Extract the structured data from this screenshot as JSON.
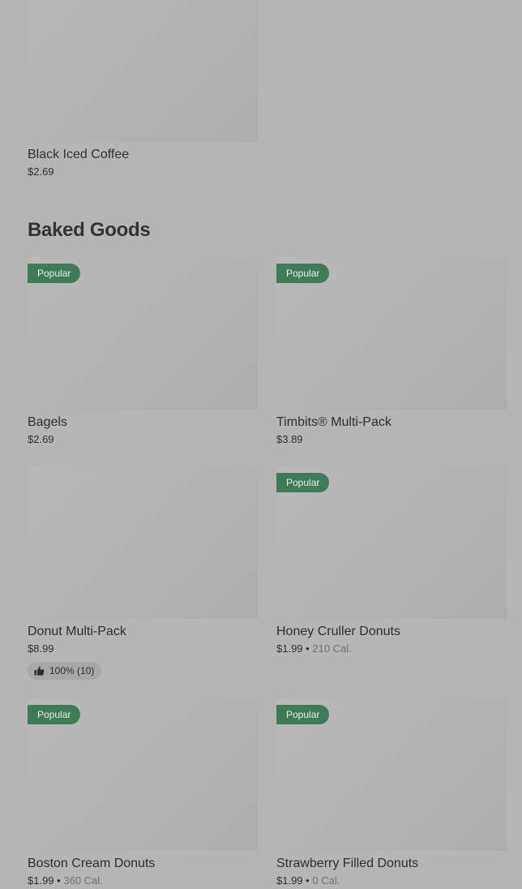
{
  "top_item": {
    "name": "Black Iced Coffee",
    "price": "$2.69"
  },
  "section": {
    "title": "Baked Goods"
  },
  "badge_label": "Popular",
  "items": [
    {
      "name": "Bagels",
      "price": "$2.69",
      "popular": true
    },
    {
      "name": "Timbits® Multi-Pack",
      "price": "$3.89",
      "popular": true
    },
    {
      "name": "Donut Multi-Pack",
      "price": "$8.99",
      "popular": false,
      "rating": "100% (10)"
    },
    {
      "name": "Honey Cruller Donuts",
      "price": "$1.99",
      "calories": "210 Cal.",
      "popular": true
    },
    {
      "name": "Boston Cream Donuts",
      "price": "$1.99",
      "calories": "360 Cal.",
      "popular": true
    },
    {
      "name": "Strawberry Filled Donuts",
      "price": "$1.99",
      "calories": "0 Cal.",
      "popular": true
    }
  ],
  "separator": "•",
  "colors": {
    "background": "#b5b5b5",
    "badge": "#3f7b57",
    "placeholder": "#b3b3b3"
  },
  "icons": {
    "rating": "thumbs-up-icon"
  }
}
